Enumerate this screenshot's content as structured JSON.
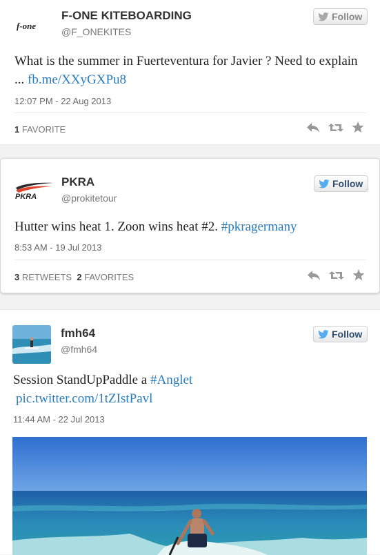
{
  "colors": {
    "link": "#2b7bb9",
    "twitter_blue": "#55acee",
    "follow_active_text": "#2f4d6b",
    "follow_inactive_text": "#8a8a8a"
  },
  "tweets": [
    {
      "name": "F-ONE KITEBOARDING",
      "handle": "@F_ONEKITES",
      "avatar_logo_text": "f-one",
      "follow_label": "Follow",
      "body_text": "What is the summer in Fuerteventura for Javier ? Need to explain ... ",
      "body_link": "fb.me/XXyGXPu8",
      "timestamp": "12:07 PM - 22 Aug 2013",
      "favorites_count": "1",
      "favorites_label": "FAVORITE"
    },
    {
      "name": "PKRA",
      "handle": "@prokitetour",
      "avatar_logo_text": "PKRA",
      "follow_label": "Follow",
      "body_text": "Hutter wins heat 1. Zoon wins heat #2. ",
      "body_link": "#pkragermany",
      "timestamp": "8:53 AM - 19 Jul 2013",
      "retweets_count": "3",
      "retweets_label": "RETWEETS",
      "favorites_count": "2",
      "favorites_label": "FAVORITES"
    },
    {
      "name": "fmh64",
      "handle": "@fmh64",
      "follow_label": "Follow",
      "body_text": "Session StandUpPaddle a ",
      "body_hashtag": "#Anglet",
      "body_link": "pic.twitter.com/1tZIstPavl",
      "timestamp": "11:44 AM - 22 Jul 2013"
    }
  ],
  "icons": {
    "reply": "reply-icon",
    "retweet": "retweet-icon",
    "favorite": "star-icon",
    "follow_bird": "twitter-bird-icon"
  }
}
